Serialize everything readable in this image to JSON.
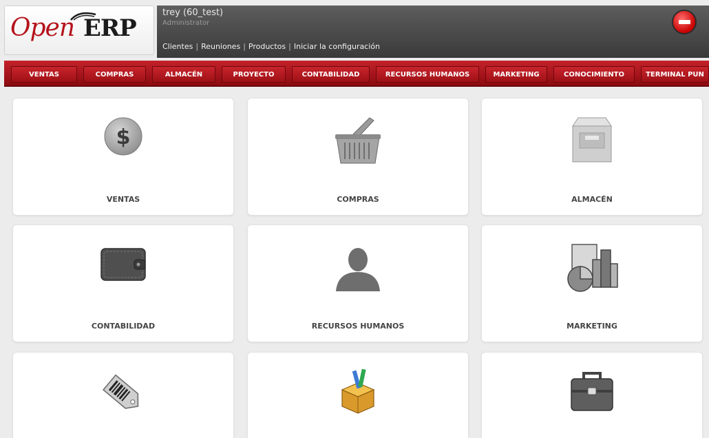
{
  "logo": {
    "open": "Open",
    "erp": "ERP"
  },
  "user": {
    "name": "trey (60_test)",
    "role": "Administrator"
  },
  "shortcuts": [
    "Clientes",
    "Reuniones",
    "Productos",
    "Iniciar la configuración"
  ],
  "menu": [
    "VENTAS",
    "COMPRAS",
    "ALMACÉN",
    "PROYECTO",
    "CONTABILIDAD",
    "RECURSOS HUMANOS",
    "MARKETING",
    "CONOCIMIENTO",
    "TERMINAL PUN"
  ],
  "tiles": [
    {
      "label": "VENTAS",
      "icon": "dollar-coin-icon"
    },
    {
      "label": "COMPRAS",
      "icon": "shopping-basket-icon"
    },
    {
      "label": "ALMACÉN",
      "icon": "warehouse-box-icon"
    },
    {
      "label": "CONTABILIDAD",
      "icon": "wallet-icon"
    },
    {
      "label": "RECURSOS HUMANOS",
      "icon": "person-icon"
    },
    {
      "label": "MARKETING",
      "icon": "chart-icon"
    },
    {
      "label": "",
      "icon": "barcode-tag-icon"
    },
    {
      "label": "",
      "icon": "package-box-icon"
    },
    {
      "label": "",
      "icon": "briefcase-icon"
    }
  ],
  "colors": {
    "brand_red": "#b5121b",
    "menu_red": "#a8141b",
    "userbar": "#4a4a4a",
    "logout": "#d40000"
  }
}
